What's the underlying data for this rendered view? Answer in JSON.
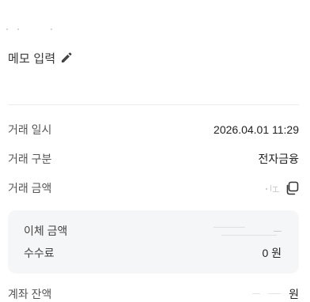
{
  "memo": {
    "label": "메모 입력",
    "icon": "pencil-icon"
  },
  "details": {
    "date_label": "거래 일시",
    "date_value": "2026.04.01 11:29",
    "type_label": "거래 구분",
    "type_value": "전자금융",
    "amount_label": "거래 금액",
    "amount_value": "",
    "amount_icon": "copy-icon"
  },
  "transfer_card": {
    "transfer_label": "이체 금액",
    "transfer_value": "",
    "fee_label": "수수료",
    "fee_value": "0 원"
  },
  "balance": {
    "label": "계좌 잔액",
    "currency": "원"
  },
  "colors": {
    "background": "#ffffff",
    "card_background": "#f5f6f8",
    "divider": "#ececec",
    "label_text": "#555555",
    "value_text": "#222222"
  }
}
